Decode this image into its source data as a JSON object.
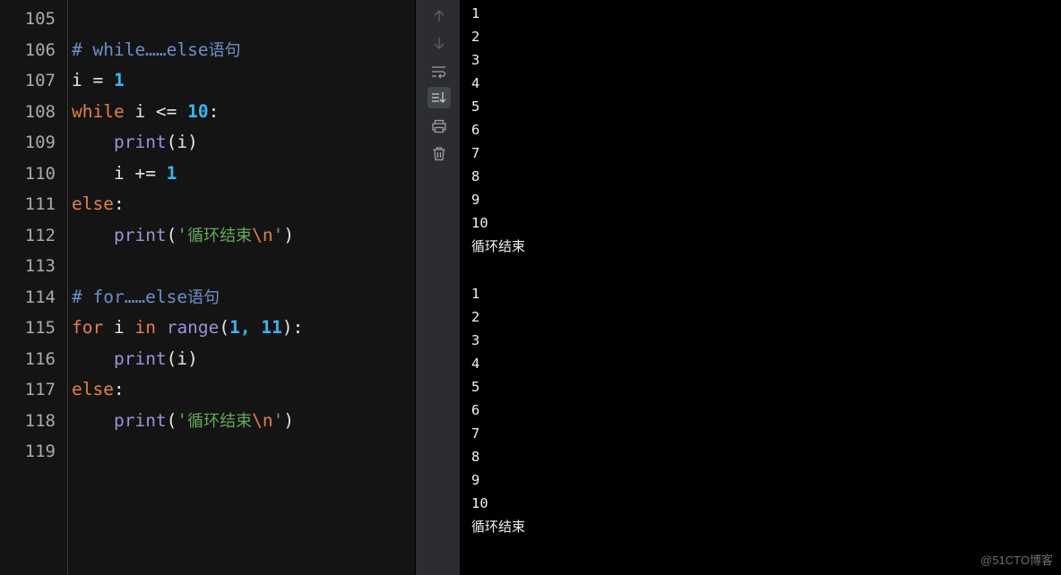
{
  "editor": {
    "line_numbers": [
      "105",
      "106",
      "107",
      "108",
      "109",
      "110",
      "111",
      "112",
      "113",
      "114",
      "115",
      "116",
      "117",
      "118",
      "119"
    ],
    "lines": {
      "l106": {
        "comment": "# while……else",
        "comment_cn": "语句"
      },
      "l107": {
        "var": "i",
        "op": " = ",
        "num": "1"
      },
      "l108": {
        "kw": "while",
        "mid": " i <= ",
        "num": "10",
        "end": ":"
      },
      "l109": {
        "indent": "    ",
        "fn": "print",
        "args": "(i)"
      },
      "l110": {
        "indent": "    ",
        "text": "i += ",
        "num": "1"
      },
      "l111": {
        "kw": "else",
        "end": ":"
      },
      "l112": {
        "indent": "    ",
        "fn": "print",
        "open": "(",
        "q1": "'",
        "str_cn": "循环结束",
        "esc": "\\n",
        "q2": "'",
        "close": ")"
      },
      "l114": {
        "comment": "# for……else",
        "comment_cn": "语句"
      },
      "l115": {
        "kw": "for",
        "mid1": " i ",
        "kw2": "in",
        "sp": " ",
        "fn": "range",
        "open": "(",
        "num1": "1,",
        "sp2": " ",
        "num2": "11",
        "close": "):"
      },
      "l116": {
        "indent": "    ",
        "fn": "print",
        "args": "(i)"
      },
      "l117": {
        "kw": "else",
        "end": ":"
      },
      "l118": {
        "indent": "    ",
        "fn": "print",
        "open": "(",
        "q1": "'",
        "str_cn": "循环结束",
        "esc": "\\n",
        "q2": "'",
        "close": ")"
      }
    }
  },
  "toolbar": {
    "icons": [
      "arrow-up-icon",
      "arrow-down-icon",
      "soft-wrap-icon",
      "scroll-to-end-icon",
      "print-icon",
      "trash-icon"
    ],
    "colors": {
      "icon": "#9da0a8",
      "icon_dim": "#5f6266"
    }
  },
  "console": {
    "output": [
      "1",
      "2",
      "3",
      "4",
      "5",
      "6",
      "7",
      "8",
      "9",
      "10",
      "循环结束",
      "",
      "1",
      "2",
      "3",
      "4",
      "5",
      "6",
      "7",
      "8",
      "9",
      "10",
      "循环结束"
    ]
  },
  "watermark": "@51CTO博客",
  "colors": {
    "keyword": "#e57f4a",
    "number": "#37b7ef",
    "function": "#9b93d6",
    "string": "#62a957",
    "comment": "#6d8fc9",
    "editor_bg": "#141414",
    "toolbar_bg": "#2b2d30",
    "console_bg": "#000000"
  }
}
